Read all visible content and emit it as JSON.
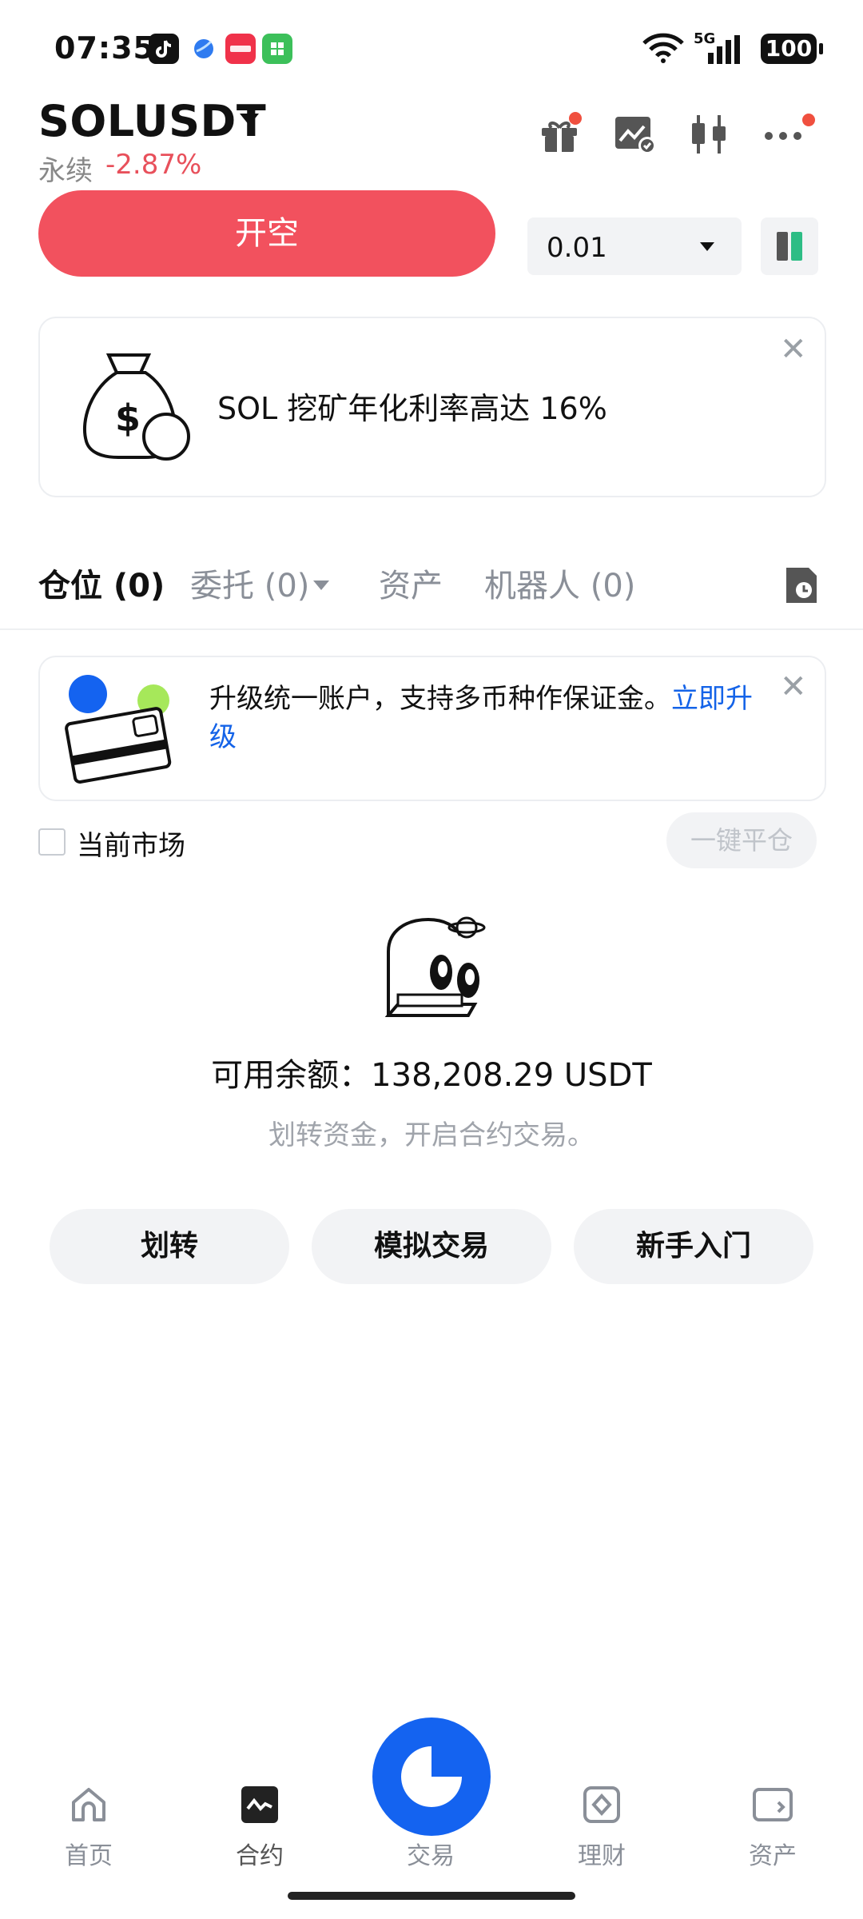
{
  "status": {
    "time": "07:35",
    "battery": "100",
    "net": "5G"
  },
  "header": {
    "symbol": "SOLUSDT",
    "contract_type": "永续",
    "change": "-2.87%"
  },
  "order": {
    "sell_label": "开空",
    "quantity": "0.01"
  },
  "promo": {
    "text": "SOL 挖矿年化利率高达 16%"
  },
  "tabs": [
    {
      "label": "仓位 (0)"
    },
    {
      "label": "委托 (0)"
    },
    {
      "label": "资产"
    },
    {
      "label": "机器人 (0)"
    }
  ],
  "upgrade": {
    "text": "升级统一账户，支持多币种作保证金。",
    "link": "立即升级"
  },
  "filter": {
    "current_market": "当前市场",
    "close_all": "一键平仓"
  },
  "empty": {
    "balance": "可用余额：138,208.29 USDT",
    "hint": "划转资金，开启合约交易。"
  },
  "actions": [
    {
      "label": "划转"
    },
    {
      "label": "模拟交易"
    },
    {
      "label": "新手入门"
    }
  ],
  "nav": [
    {
      "label": "首页"
    },
    {
      "label": "合约"
    },
    {
      "label": "交易"
    },
    {
      "label": "理财"
    },
    {
      "label": "资产"
    }
  ],
  "colors": {
    "sell": "#f2515e",
    "accent": "#1463f0",
    "negative": "#e8505b"
  }
}
